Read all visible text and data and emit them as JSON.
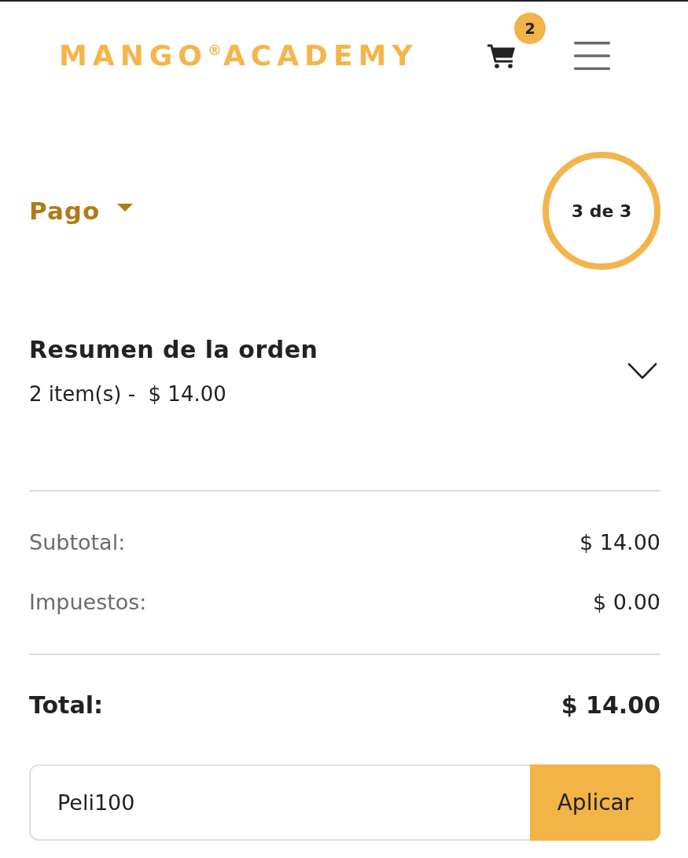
{
  "header": {
    "logo": "MANGO$^{®}$ACADEMY",
    "cart_count": "2"
  },
  "step": {
    "title": "Pago",
    "counter": "3 de 3"
  },
  "order_summary": {
    "title": "Resumen de la orden",
    "detail": "2 item(s) -  $ 14.00",
    "expanded": false
  },
  "lines": [
    {
      "label": "Subtotal:",
      "value": "$ 14.00"
    },
    {
      "label": "Impuestos:",
      "value": "$ 0.00"
    }
  ],
  "total": {
    "label": "Total:",
    "value": "$ 14.00"
  },
  "coupon": {
    "value": "Peli100",
    "button": "Aplicar"
  }
}
